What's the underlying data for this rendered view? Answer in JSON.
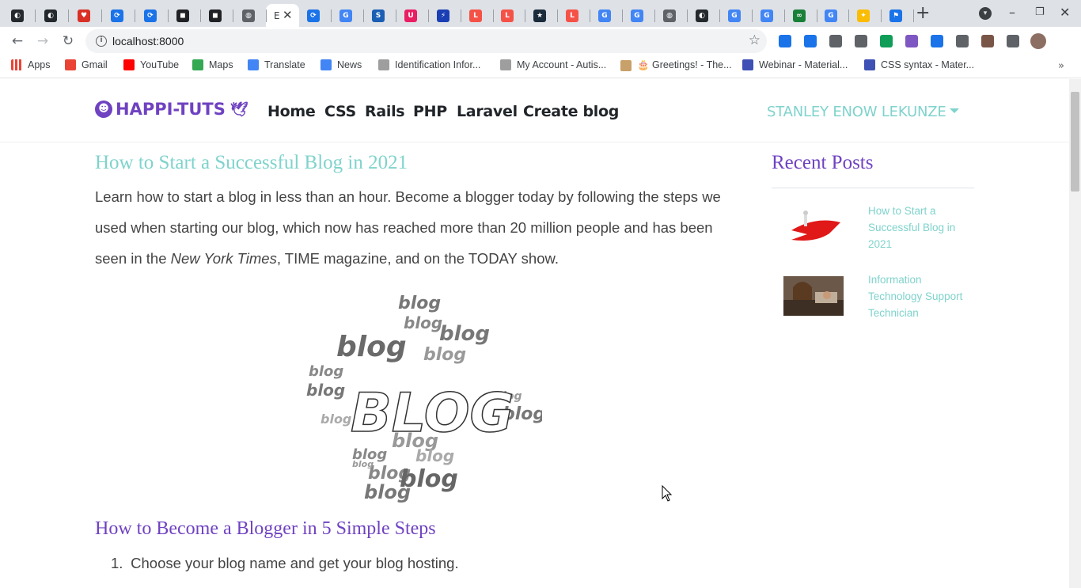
{
  "browser": {
    "tabs": [
      {
        "icon": "github-icon",
        "color": "#24292e",
        "glyph": "◐"
      },
      {
        "icon": "github-icon",
        "color": "#24292e",
        "glyph": "◐"
      },
      {
        "icon": "shield-icon",
        "color": "#d93025",
        "glyph": "♥"
      },
      {
        "icon": "link-icon",
        "color": "#1a73e8",
        "glyph": "⟳"
      },
      {
        "icon": "link-icon",
        "color": "#1a73e8",
        "glyph": "⟳"
      },
      {
        "icon": "dark-square-icon",
        "color": "#202124",
        "glyph": "◼"
      },
      {
        "icon": "dark-square-icon",
        "color": "#202124",
        "glyph": "◼"
      },
      {
        "icon": "globe-icon",
        "color": "#5f6368",
        "glyph": "◍"
      }
    ],
    "active_tab": {
      "label": "E"
    },
    "tabs_right": [
      {
        "icon": "link-icon",
        "color": "#1a73e8",
        "glyph": "⟳"
      },
      {
        "icon": "google-icon",
        "color": "#4285f4",
        "glyph": "G"
      },
      {
        "icon": "stacks-icon",
        "color": "#1a5fb4",
        "glyph": "S"
      },
      {
        "icon": "u-icon",
        "color": "#e91e63",
        "glyph": "U"
      },
      {
        "icon": "bolt-icon",
        "color": "#1a3fb4",
        "glyph": "⚡"
      },
      {
        "icon": "laravel-icon",
        "color": "#f55247",
        "glyph": "L"
      },
      {
        "icon": "laravel-icon",
        "color": "#f55247",
        "glyph": "L"
      },
      {
        "icon": "star-icon",
        "color": "#1a2b3c",
        "glyph": "★"
      },
      {
        "icon": "laravel-icon",
        "color": "#f55247",
        "glyph": "L"
      },
      {
        "icon": "google-icon",
        "color": "#4285f4",
        "glyph": "G"
      },
      {
        "icon": "google-icon",
        "color": "#4285f4",
        "glyph": "G"
      },
      {
        "icon": "globe-icon",
        "color": "#5f6368",
        "glyph": "◍"
      },
      {
        "icon": "github-icon",
        "color": "#24292e",
        "glyph": "◐"
      },
      {
        "icon": "google-icon",
        "color": "#4285f4",
        "glyph": "G"
      },
      {
        "icon": "google-icon",
        "color": "#4285f4",
        "glyph": "G"
      },
      {
        "icon": "infinity-icon",
        "color": "#188038",
        "glyph": "∞"
      },
      {
        "icon": "google-icon",
        "color": "#4285f4",
        "glyph": "G"
      },
      {
        "icon": "puzzle-color-icon",
        "color": "#fbbc04",
        "glyph": "✦"
      },
      {
        "icon": "flag-icon",
        "color": "#1a73e8",
        "glyph": "⚑"
      }
    ],
    "new_tab": "+",
    "url": "localhost:8000",
    "extensions": [
      "#1a73e8",
      "#1a73e8",
      "#5f6368",
      "#5f6368",
      "#0f9d58",
      "#7e57c2",
      "#1a73e8",
      "#5f6368",
      "#795548",
      "#5f6368",
      "#8d6e63"
    ],
    "bookmarks": [
      {
        "label": "Apps",
        "color": "#ea4335"
      },
      {
        "label": "Gmail",
        "color": "#ea4335"
      },
      {
        "label": "YouTube",
        "color": "#ff0000"
      },
      {
        "label": "Maps",
        "color": "#34a853"
      },
      {
        "label": "Translate",
        "color": "#4285f4"
      },
      {
        "label": "News",
        "color": "#4285f4"
      },
      {
        "label": "Identification Infor...",
        "color": "#9e9e9e"
      },
      {
        "label": "My Account - Autis...",
        "color": "#9e9e9e"
      },
      {
        "label": "🎂 Greetings! - The...",
        "color": "#c8a06a"
      },
      {
        "label": "Webinar - Material...",
        "color": "#3f51b5"
      },
      {
        "label": "CSS syntax - Mater...",
        "color": "#3f51b5"
      }
    ]
  },
  "site": {
    "brand": "HAPPI-TUTS",
    "nav": [
      "Home",
      "CSS",
      "Rails",
      "PHP",
      "Laravel",
      "Create blog"
    ],
    "user": "STANLEY ENOW LEKUNZE"
  },
  "post": {
    "title": "How to Start a Successful Blog in 2021",
    "intro_1": "Learn how to start a blog in less than an hour. Become a blogger today by following the steps we used when starting our blog, which now has reached more than 20 million people and has been seen in the ",
    "intro_em": "New York Times",
    "intro_2": ", TIME magazine, and on the TODAY show.",
    "image_text": "BLOG",
    "image_words": "blog",
    "subheading": "How to Become a Blogger in 5 Simple Steps",
    "steps": [
      {
        "num": "1.",
        "text": "Choose your blog name and get your blog hosting."
      }
    ]
  },
  "sidebar": {
    "title": "Recent Posts",
    "posts": [
      {
        "title": "How to Start a Successful Blog in 2021"
      },
      {
        "title": "Information Technology Support Technician"
      }
    ]
  },
  "colors": {
    "purple": "#6f42c1",
    "teal": "#7fd3cc",
    "text": "#444444"
  }
}
